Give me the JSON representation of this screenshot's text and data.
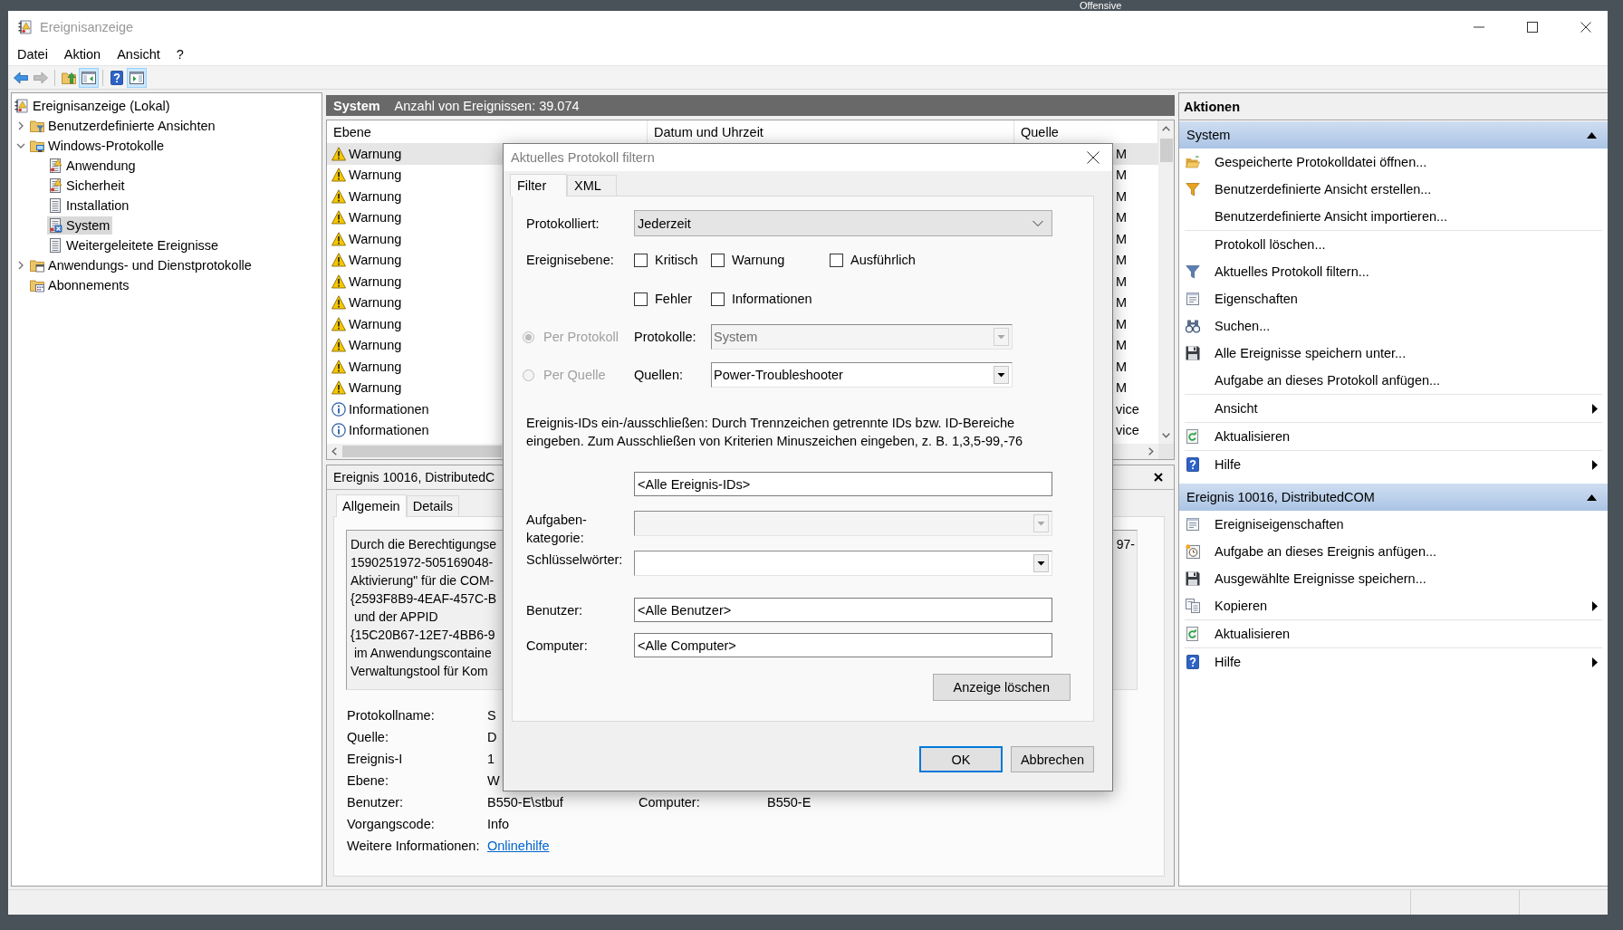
{
  "desktop": {
    "icon_label": "Offensive"
  },
  "window": {
    "title": "Ereignisanzeige"
  },
  "menu": [
    "Datei",
    "Aktion",
    "Ansicht",
    "?"
  ],
  "toolbar": [
    {
      "buttons": [
        {
          "kind": "back",
          "disabled": false,
          "pressed": false
        },
        {
          "kind": "forward",
          "disabled": true,
          "pressed": false
        }
      ]
    },
    {
      "buttons": [
        {
          "kind": "up",
          "disabled": false,
          "pressed": false
        },
        {
          "kind": "console-tree",
          "disabled": false,
          "pressed": true
        }
      ]
    },
    {
      "buttons": [
        {
          "kind": "help",
          "disabled": false,
          "pressed": false
        },
        {
          "kind": "action-pane",
          "disabled": false,
          "pressed": true
        }
      ]
    }
  ],
  "tree": [
    {
      "label": "Ereignisanzeige (Lokal)",
      "kind": "viewer",
      "selected": false,
      "children": [
        {
          "label": "Benutzerdefinierte Ansichten",
          "kind": "custom-views",
          "expanded": false,
          "selected": false
        },
        {
          "label": "Windows-Protokolle",
          "kind": "windows-logs",
          "expanded": true,
          "selected": false,
          "children": [
            {
              "label": "Anwendung",
              "kind": "alert-log",
              "selected": false
            },
            {
              "label": "Sicherheit",
              "kind": "alert-log",
              "selected": false
            },
            {
              "label": "Installation",
              "kind": "log",
              "selected": false
            },
            {
              "label": "System",
              "kind": "system-log",
              "selected": true
            },
            {
              "label": "Weitergeleitete Ereignisse",
              "kind": "log",
              "selected": false
            }
          ]
        },
        {
          "label": "Anwendungs- und Dienstprotokolle",
          "kind": "app-logs",
          "expanded": false,
          "selected": false
        },
        {
          "label": "Abonnements",
          "kind": "subscriptions",
          "selected": false
        }
      ]
    }
  ],
  "log_header": {
    "title": "System",
    "count": "Anzahl von Ereignissen: 39.074"
  },
  "table": {
    "columns": [
      "Ebene",
      "Datum und Uhrzeit",
      "Quelle"
    ],
    "rows": [
      {
        "level": "Warnung",
        "kind": "warning",
        "source": "M",
        "selected": true
      },
      {
        "level": "Warnung",
        "kind": "warning",
        "source": "M",
        "selected": false
      },
      {
        "level": "Warnung",
        "kind": "warning",
        "source": "M",
        "selected": false
      },
      {
        "level": "Warnung",
        "kind": "warning",
        "source": "M",
        "selected": false
      },
      {
        "level": "Warnung",
        "kind": "warning",
        "source": "M",
        "selected": false
      },
      {
        "level": "Warnung",
        "kind": "warning",
        "source": "M",
        "selected": false
      },
      {
        "level": "Warnung",
        "kind": "warning",
        "source": "M",
        "selected": false
      },
      {
        "level": "Warnung",
        "kind": "warning",
        "source": "M",
        "selected": false
      },
      {
        "level": "Warnung",
        "kind": "warning",
        "source": "M",
        "selected": false
      },
      {
        "level": "Warnung",
        "kind": "warning",
        "source": "M",
        "selected": false
      },
      {
        "level": "Warnung",
        "kind": "warning",
        "source": "M",
        "selected": false
      },
      {
        "level": "Warnung",
        "kind": "warning",
        "source": "M",
        "selected": false
      },
      {
        "level": "Informationen",
        "kind": "info",
        "source": "vice",
        "selected": false
      },
      {
        "level": "Informationen",
        "kind": "info",
        "source": "vice",
        "selected": false
      }
    ]
  },
  "event_detail": {
    "title": "Ereignis 10016, DistributedC",
    "tabs": [
      {
        "label": "Allgemein",
        "selected": true
      },
      {
        "label": "Details",
        "selected": false
      }
    ],
    "description_lines": [
      "Durch die Berechtigungse",
      "1590251972-505169048-",
      "Aktivierung\" für die COM-",
      "{2593F8B9-4EAF-457C-B",
      " und der APPID",
      "{15C20B67-12E7-4BB6-9",
      " im Anwendungscontaine",
      "Verwaltungstool für Kom"
    ],
    "description_tail": "97-",
    "fields": [
      [
        {
          "label": "Protokollname:",
          "value": "S"
        }
      ],
      [
        {
          "label": "Quelle:",
          "value": "D"
        }
      ],
      [
        {
          "label": "Ereignis-I",
          "value": "1"
        }
      ],
      [
        {
          "label": "Ebene:",
          "value": "W"
        }
      ],
      [
        {
          "label": "Benutzer:",
          "value": "B550-E\\stbuf"
        },
        {
          "label": "Computer:",
          "value": "B550-E"
        }
      ],
      [
        {
          "label": "Vorgangscode:",
          "value": "Info"
        }
      ]
    ],
    "more_info": {
      "label": "Weitere Informationen:",
      "link": "Onlinehilfe"
    }
  },
  "actions": {
    "title": "Aktionen",
    "sections": [
      {
        "title": "System",
        "expanded": true,
        "items": [
          {
            "label": "Gespeicherte Protokolldatei öffnen...",
            "kind": "open",
            "divider_above": false,
            "submenu": false
          },
          {
            "label": "Benutzerdefinierte Ansicht erstellen...",
            "kind": "create-view",
            "divider_above": false,
            "submenu": false
          },
          {
            "label": "Benutzerdefinierte Ansicht importieren...",
            "kind": "import-view",
            "divider_above": false,
            "submenu": false
          },
          {
            "label": "Protokoll löschen...",
            "kind": "clear-log",
            "divider_above": true,
            "submenu": false
          },
          {
            "label": "Aktuelles Protokoll filtern...",
            "kind": "filter",
            "divider_above": false,
            "submenu": false
          },
          {
            "label": "Eigenschaften",
            "kind": "properties",
            "divider_above": false,
            "submenu": false
          },
          {
            "label": "Suchen...",
            "kind": "find",
            "divider_above": false,
            "submenu": false
          },
          {
            "label": "Alle Ereignisse speichern unter...",
            "kind": "save",
            "divider_above": false,
            "submenu": false
          },
          {
            "label": "Aufgabe an dieses Protokoll anfügen...",
            "kind": "attach-task",
            "divider_above": false,
            "submenu": false
          },
          {
            "label": "Ansicht",
            "kind": "view",
            "divider_above": true,
            "submenu": true
          },
          {
            "label": "Aktualisieren",
            "kind": "refresh",
            "divider_above": true,
            "submenu": false
          },
          {
            "label": "Hilfe",
            "kind": "help",
            "divider_above": true,
            "submenu": true
          }
        ]
      },
      {
        "title": "Ereignis 10016, DistributedCOM",
        "expanded": true,
        "items": [
          {
            "label": "Ereigniseigenschaften",
            "kind": "event-properties",
            "divider_above": false,
            "submenu": false
          },
          {
            "label": "Aufgabe an dieses Ereignis anfügen...",
            "kind": "attach-event-task",
            "divider_above": false,
            "submenu": false
          },
          {
            "label": "Ausgewählte Ereignisse speichern...",
            "kind": "save",
            "divider_above": false,
            "submenu": false
          },
          {
            "label": "Kopieren",
            "kind": "copy",
            "divider_above": false,
            "submenu": true
          },
          {
            "label": "Aktualisieren",
            "kind": "refresh",
            "divider_above": true,
            "submenu": false
          },
          {
            "label": "Hilfe",
            "kind": "help",
            "divider_above": true,
            "submenu": true
          }
        ]
      }
    ]
  },
  "filter_dialog": {
    "title": "Aktuelles Protokoll filtern",
    "tabs": [
      {
        "label": "Filter",
        "selected": true
      },
      {
        "label": "XML",
        "selected": false
      }
    ],
    "logged": {
      "label": "Protokolliert:",
      "value": "Jederzeit"
    },
    "event_levels": {
      "label": "Ereignisebene:",
      "options": [
        {
          "label": "Kritisch",
          "checked": false
        },
        {
          "label": "Warnung",
          "checked": false
        },
        {
          "label": "Ausführlich",
          "checked": false
        },
        {
          "label": "Fehler",
          "checked": false
        },
        {
          "label": "Informationen",
          "checked": false
        }
      ]
    },
    "scope": [
      {
        "label": "Per Protokoll",
        "selected": true,
        "disabled": true,
        "field": {
          "label": "Protokolle:",
          "value": "System",
          "disabled": true
        }
      },
      {
        "label": "Per Quelle",
        "selected": false,
        "disabled": true,
        "field": {
          "label": "Quellen:",
          "value": "Power-Troubleshooter",
          "disabled": false
        }
      }
    ],
    "id_hint": "Ereignis-IDs ein-/ausschließen: Durch Trennzeichen getrennte IDs bzw. ID-Bereiche eingeben. Zum Ausschließen von Kriterien Minuszeichen eingeben, z. B. 1,3,5-99,-76",
    "event_ids": {
      "value": "<Alle Ereignis-IDs>"
    },
    "task_category": {
      "label": "Aufgaben-kategorie:",
      "disabled": true
    },
    "keywords": {
      "label": "Schlüsselwörter:",
      "disabled": false
    },
    "user": {
      "label": "Benutzer:",
      "value": "<Alle Benutzer>"
    },
    "computer": {
      "label": "Computer:",
      "value": "<Alle Computer>"
    },
    "clear_button": "Anzeige löschen",
    "buttons": [
      {
        "label": "OK",
        "default": true
      },
      {
        "label": "Abbrechen",
        "default": false
      }
    ]
  }
}
